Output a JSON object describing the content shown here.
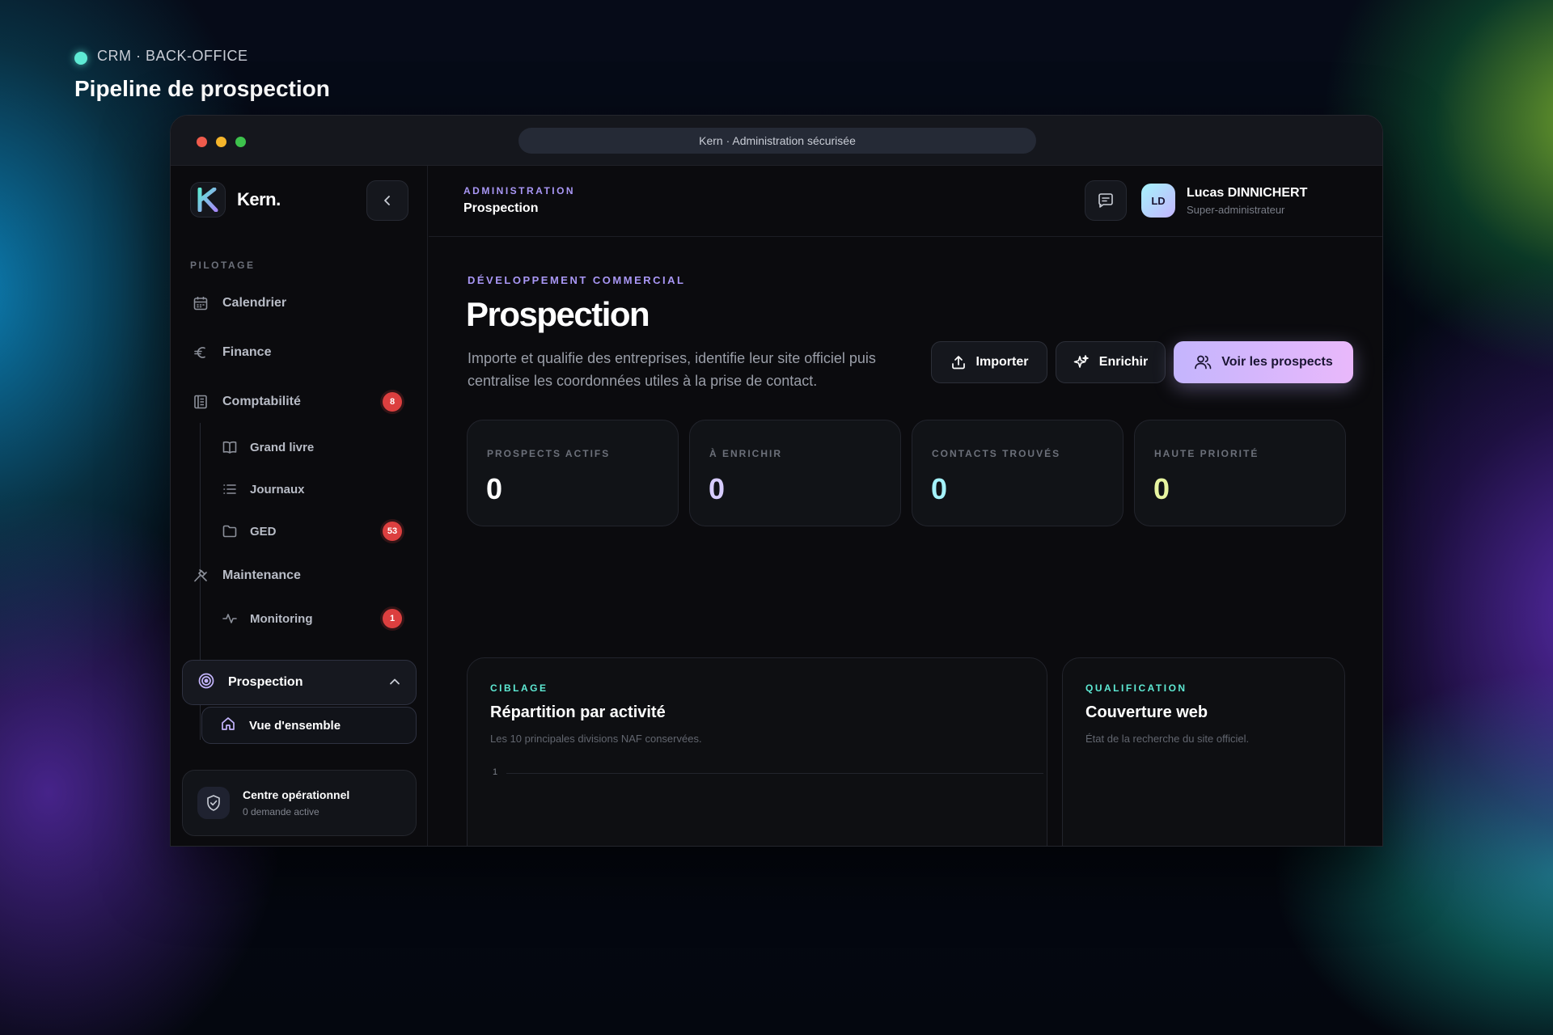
{
  "caption": {
    "kicker": "CRM · BACK-OFFICE",
    "title": "Pipeline de prospection"
  },
  "window": {
    "url": "Kern · Administration sécurisée"
  },
  "sidebar": {
    "brand": "Kern.",
    "section_label": "PILOTAGE",
    "items": [
      {
        "label": "Calendrier",
        "icon": "calendar-icon"
      },
      {
        "label": "Finance",
        "icon": "euro-icon"
      },
      {
        "label": "Comptabilité",
        "icon": "ledger-icon",
        "badge": "8"
      },
      {
        "label": "Grand livre",
        "icon": "book-icon"
      },
      {
        "label": "Journaux",
        "icon": "list-icon"
      },
      {
        "label": "GED",
        "icon": "folder-icon",
        "badge": "53"
      },
      {
        "label": "Maintenance",
        "icon": "hammer-icon"
      },
      {
        "label": "Monitoring",
        "icon": "pulse-icon",
        "badge": "1"
      },
      {
        "label": "Prospection",
        "icon": "target-icon"
      },
      {
        "label": "Vue d'ensemble",
        "icon": "home-icon"
      }
    ],
    "ops": {
      "title": "Centre opérationnel",
      "subtitle": "0 demande active"
    }
  },
  "header": {
    "kicker": "ADMINISTRATION",
    "title": "Prospection",
    "user": {
      "initials": "LD",
      "name": "Lucas DINNICHERT",
      "role": "Super-administrateur"
    }
  },
  "main": {
    "kicker": "DÉVELOPPEMENT COMMERCIAL",
    "title": "Prospection",
    "description": "Importe et qualifie des entreprises, identifie leur site officiel puis centralise les coordonnées utiles à la prise de contact.",
    "buttons": {
      "import": "Importer",
      "enrich": "Enrichir",
      "view": "Voir les prospects"
    },
    "stats": [
      {
        "label": "PROSPECTS ACTIFS",
        "value": "0",
        "color": "#ffffff"
      },
      {
        "label": "À ENRICHIR",
        "value": "0",
        "color": "#d7ccff"
      },
      {
        "label": "CONTACTS TROUVÉS",
        "value": "0",
        "color": "#a5f3fc"
      },
      {
        "label": "HAUTE PRIORITÉ",
        "value": "0",
        "color": "#e7f5a1"
      }
    ],
    "panels": {
      "activity": {
        "kicker": "CIBLAGE",
        "title": "Répartition par activité",
        "subtitle": "Les 10 principales divisions NAF conservées.",
        "axis_tick": "1"
      },
      "web": {
        "kicker": "QUALIFICATION",
        "title": "Couverture web",
        "subtitle": "État de la recherche du site officiel."
      }
    }
  },
  "colors": {
    "accent": "#c4b5fd",
    "teal": "#5eead4",
    "badge": "#dc3f3f",
    "background": "#0b0b0e"
  }
}
